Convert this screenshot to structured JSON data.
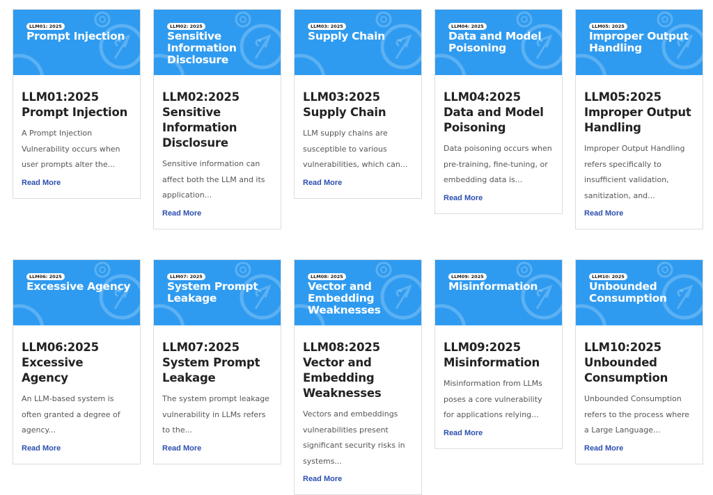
{
  "colors": {
    "banner_blue": "#2f9bf0",
    "link_blue": "#2c4fb0",
    "title_text": "#222222",
    "body_text": "#555555"
  },
  "cards": [
    {
      "badge": "LLM01: 2025",
      "banner_title": "Prompt Injection",
      "title": "LLM01:2025 Prompt Injection",
      "excerpt": "A Prompt Injection Vulnerability occurs when user prompts alter the...",
      "link": "Read More",
      "icon": "owasp-wasp-logo-icon"
    },
    {
      "badge": "LLM02: 2025",
      "banner_title": "Sensitive Information Disclosure",
      "title": "LLM02:2025 Sensitive Information Disclosure",
      "excerpt": "Sensitive information can affect both the LLM and its application...",
      "link": "Read More",
      "icon": "owasp-wasp-logo-icon"
    },
    {
      "badge": "LLM03: 2025",
      "banner_title": "Supply Chain",
      "title": "LLM03:2025 Supply Chain",
      "excerpt": "LLM supply chains are susceptible to various vulnerabilities, which can...",
      "link": "Read More",
      "icon": "owasp-wasp-logo-icon"
    },
    {
      "badge": "LLM04: 2025",
      "banner_title": "Data and Model Poisoning",
      "title": "LLM04:2025 Data and Model Poisoning",
      "excerpt": "Data poisoning occurs when pre-training, fine-tuning, or embedding data is...",
      "link": "Read More",
      "icon": "owasp-wasp-logo-icon"
    },
    {
      "badge": "LLM05: 2025",
      "banner_title": "Improper Output Handling",
      "title": "LLM05:2025 Improper Output Handling",
      "excerpt": "Improper Output Handling refers specifically to insufficient validation, sanitization, and...",
      "link": "Read More",
      "icon": "owasp-wasp-logo-icon"
    },
    {
      "badge": "LLM06: 2025",
      "banner_title": "Excessive Agency",
      "title": "LLM06:2025 Excessive Agency",
      "excerpt": "An LLM-based system is often granted a degree of agency...",
      "link": "Read More",
      "icon": "owasp-wasp-logo-icon"
    },
    {
      "badge": "LLM07: 2025",
      "banner_title": "System Prompt Leakage",
      "title": "LLM07:2025 System Prompt Leakage",
      "excerpt": "The system prompt leakage vulnerability in LLMs refers to the...",
      "link": "Read More",
      "icon": "owasp-wasp-logo-icon"
    },
    {
      "badge": "LLM08: 2025",
      "banner_title": "Vector and Embedding Weaknesses",
      "title": "LLM08:2025 Vector and Embedding Weaknesses",
      "excerpt": "Vectors and embeddings vulnerabilities present significant security risks in systems...",
      "link": "Read More",
      "icon": "owasp-wasp-logo-icon"
    },
    {
      "badge": "LLM09: 2025",
      "banner_title": "Misinformation",
      "title": "LLM09:2025 Misinformation",
      "excerpt": "Misinformation from LLMs poses a core vulnerability for applications relying...",
      "link": "Read More",
      "icon": "owasp-wasp-logo-icon"
    },
    {
      "badge": "LLM10: 2025",
      "banner_title": "Unbounded Consumption",
      "title": "LLM10:2025 Unbounded Consumption",
      "excerpt": "Unbounded Consumption refers to the process where a Large Language...",
      "link": "Read More",
      "icon": "owasp-wasp-logo-icon"
    }
  ]
}
